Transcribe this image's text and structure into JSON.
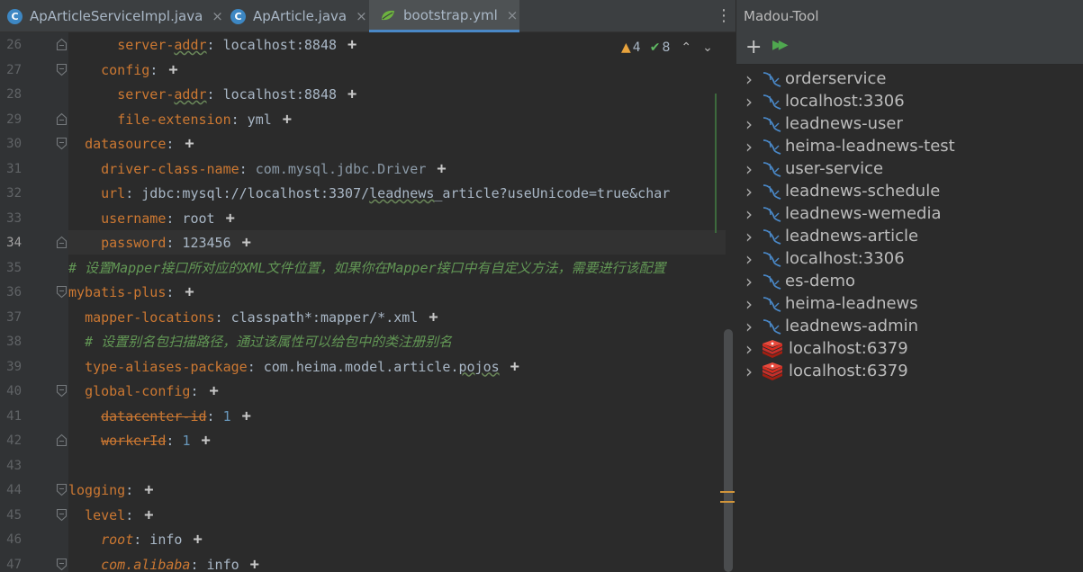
{
  "tabs": [
    {
      "label": "ApArticleServiceImpl.java",
      "icon": "java-class-icon",
      "icon_letter": "C",
      "active": false
    },
    {
      "label": "ApArticle.java",
      "icon": "java-class-icon",
      "icon_letter": "C",
      "active": false
    },
    {
      "label": "bootstrap.yml",
      "icon": "spring-leaf-icon",
      "active": true
    }
  ],
  "tab_close": "×",
  "tab_menu": "⋮",
  "status": {
    "warnings": "4",
    "checks": "8",
    "warn_icon": "▲",
    "check_icon": "✔",
    "prev": "⌃",
    "next": "⌄"
  },
  "editor": {
    "current_line": "34",
    "lines": [
      {
        "n": "26",
        "parts": [
          {
            "t": "      ",
            "c": "v"
          },
          {
            "t": "server-",
            "c": "k"
          },
          {
            "t": "addr",
            "c": "k sq"
          },
          {
            "t": ": localhost:8848",
            "c": "v"
          }
        ],
        "plus": true
      },
      {
        "n": "27",
        "parts": [
          {
            "t": "    ",
            "c": "v"
          },
          {
            "t": "config",
            "c": "k"
          },
          {
            "t": ":",
            "c": "v"
          }
        ],
        "plus": true
      },
      {
        "n": "28",
        "parts": [
          {
            "t": "      ",
            "c": "v"
          },
          {
            "t": "server-",
            "c": "k"
          },
          {
            "t": "addr",
            "c": "k sq"
          },
          {
            "t": ": localhost:8848",
            "c": "v"
          }
        ],
        "plus": true
      },
      {
        "n": "29",
        "parts": [
          {
            "t": "      ",
            "c": "v"
          },
          {
            "t": "file-extension",
            "c": "k"
          },
          {
            "t": ": yml",
            "c": "v"
          }
        ],
        "plus": true
      },
      {
        "n": "30",
        "parts": [
          {
            "t": "  ",
            "c": "v"
          },
          {
            "t": "datasource",
            "c": "k"
          },
          {
            "t": ":",
            "c": "v"
          }
        ],
        "plus": true
      },
      {
        "n": "31",
        "parts": [
          {
            "t": "    ",
            "c": "v"
          },
          {
            "t": "driver-class-name",
            "c": "k"
          },
          {
            "t": ": ",
            "c": "v"
          },
          {
            "t": "com.mysql.jdbc.Driver",
            "c": "v dim"
          }
        ],
        "plus": true
      },
      {
        "n": "32",
        "parts": [
          {
            "t": "    ",
            "c": "v"
          },
          {
            "t": "url",
            "c": "k"
          },
          {
            "t": ": jdbc:mysql://localhost:3307/",
            "c": "v"
          },
          {
            "t": "leadnews",
            "c": "v sq"
          },
          {
            "t": "_article?useUnicode=true&char",
            "c": "v"
          }
        ],
        "plus": false
      },
      {
        "n": "33",
        "parts": [
          {
            "t": "    ",
            "c": "v"
          },
          {
            "t": "username",
            "c": "k"
          },
          {
            "t": ": root",
            "c": "v"
          }
        ],
        "plus": true
      },
      {
        "n": "34",
        "parts": [
          {
            "t": "    ",
            "c": "v"
          },
          {
            "t": "password",
            "c": "k"
          },
          {
            "t": ": 123456",
            "c": "v"
          }
        ],
        "plus": true
      },
      {
        "n": "35",
        "parts": [
          {
            "t": "# 设置Mapper接口所对应的XML文件位置，如果你在Mapper接口中有自定义方法，需要进行该配置",
            "c": "c"
          }
        ],
        "plus": false
      },
      {
        "n": "36",
        "parts": [
          {
            "t": "mybatis-plus",
            "c": "k"
          },
          {
            "t": ":",
            "c": "v"
          }
        ],
        "plus": true
      },
      {
        "n": "37",
        "parts": [
          {
            "t": "  ",
            "c": "v"
          },
          {
            "t": "mapper-locations",
            "c": "k"
          },
          {
            "t": ": classpath*:mapper/*.xml",
            "c": "v"
          }
        ],
        "plus": true
      },
      {
        "n": "38",
        "parts": [
          {
            "t": "  ",
            "c": "v"
          },
          {
            "t": "# 设置别名包扫描路径，通过该属性可以给包中的类注册别名",
            "c": "c"
          }
        ],
        "plus": false
      },
      {
        "n": "39",
        "parts": [
          {
            "t": "  ",
            "c": "v"
          },
          {
            "t": "type-aliases-package",
            "c": "k"
          },
          {
            "t": ": com.heima.model.article.",
            "c": "v"
          },
          {
            "t": "pojos",
            "c": "v sq"
          }
        ],
        "plus": true
      },
      {
        "n": "40",
        "parts": [
          {
            "t": "  ",
            "c": "v"
          },
          {
            "t": "global-config",
            "c": "k"
          },
          {
            "t": ":",
            "c": "v"
          }
        ],
        "plus": true
      },
      {
        "n": "41",
        "parts": [
          {
            "t": "    ",
            "c": "v"
          },
          {
            "t": "datacenter-id",
            "c": "dep"
          },
          {
            "t": ": ",
            "c": "v"
          },
          {
            "t": "1",
            "c": "num"
          }
        ],
        "plus": true
      },
      {
        "n": "42",
        "parts": [
          {
            "t": "    ",
            "c": "v"
          },
          {
            "t": "workerId",
            "c": "dep"
          },
          {
            "t": ": ",
            "c": "v"
          },
          {
            "t": "1",
            "c": "num"
          }
        ],
        "plus": true
      },
      {
        "n": "43",
        "parts": [],
        "plus": false
      },
      {
        "n": "44",
        "parts": [
          {
            "t": "logging",
            "c": "k"
          },
          {
            "t": ":",
            "c": "v"
          }
        ],
        "plus": true
      },
      {
        "n": "45",
        "parts": [
          {
            "t": "  ",
            "c": "v"
          },
          {
            "t": "level",
            "c": "k"
          },
          {
            "t": ":",
            "c": "v"
          }
        ],
        "plus": true
      },
      {
        "n": "46",
        "parts": [
          {
            "t": "    ",
            "c": "v"
          },
          {
            "t": "root",
            "c": "it"
          },
          {
            "t": ": info",
            "c": "v"
          }
        ],
        "plus": true
      },
      {
        "n": "47",
        "parts": [
          {
            "t": "    ",
            "c": "v"
          },
          {
            "t": "com.alibaba",
            "c": "it"
          },
          {
            "t": ": info",
            "c": "v"
          }
        ],
        "plus": true
      }
    ]
  },
  "panel": {
    "title": "Madou-Tool",
    "add_icon": "+",
    "run_icon": "▶▶",
    "items": [
      {
        "label": "orderservice",
        "type": "mysql"
      },
      {
        "label": "localhost:3306",
        "type": "mysql"
      },
      {
        "label": "leadnews-user",
        "type": "mysql"
      },
      {
        "label": "heima-leadnews-test",
        "type": "mysql"
      },
      {
        "label": "user-service",
        "type": "mysql"
      },
      {
        "label": "leadnews-schedule",
        "type": "mysql"
      },
      {
        "label": "leadnews-wemedia",
        "type": "mysql"
      },
      {
        "label": "leadnews-article",
        "type": "mysql"
      },
      {
        "label": "localhost:3306",
        "type": "mysql"
      },
      {
        "label": "es-demo",
        "type": "mysql"
      },
      {
        "label": "heima-leadnews",
        "type": "mysql"
      },
      {
        "label": "leadnews-admin",
        "type": "mysql"
      },
      {
        "label": "localhost:6379",
        "type": "redis"
      },
      {
        "label": "localhost:6379",
        "type": "redis"
      }
    ]
  },
  "colors": {
    "key": "#cc7832",
    "comment": "#629755",
    "number": "#6897bb",
    "accent": "#4a88c7"
  }
}
